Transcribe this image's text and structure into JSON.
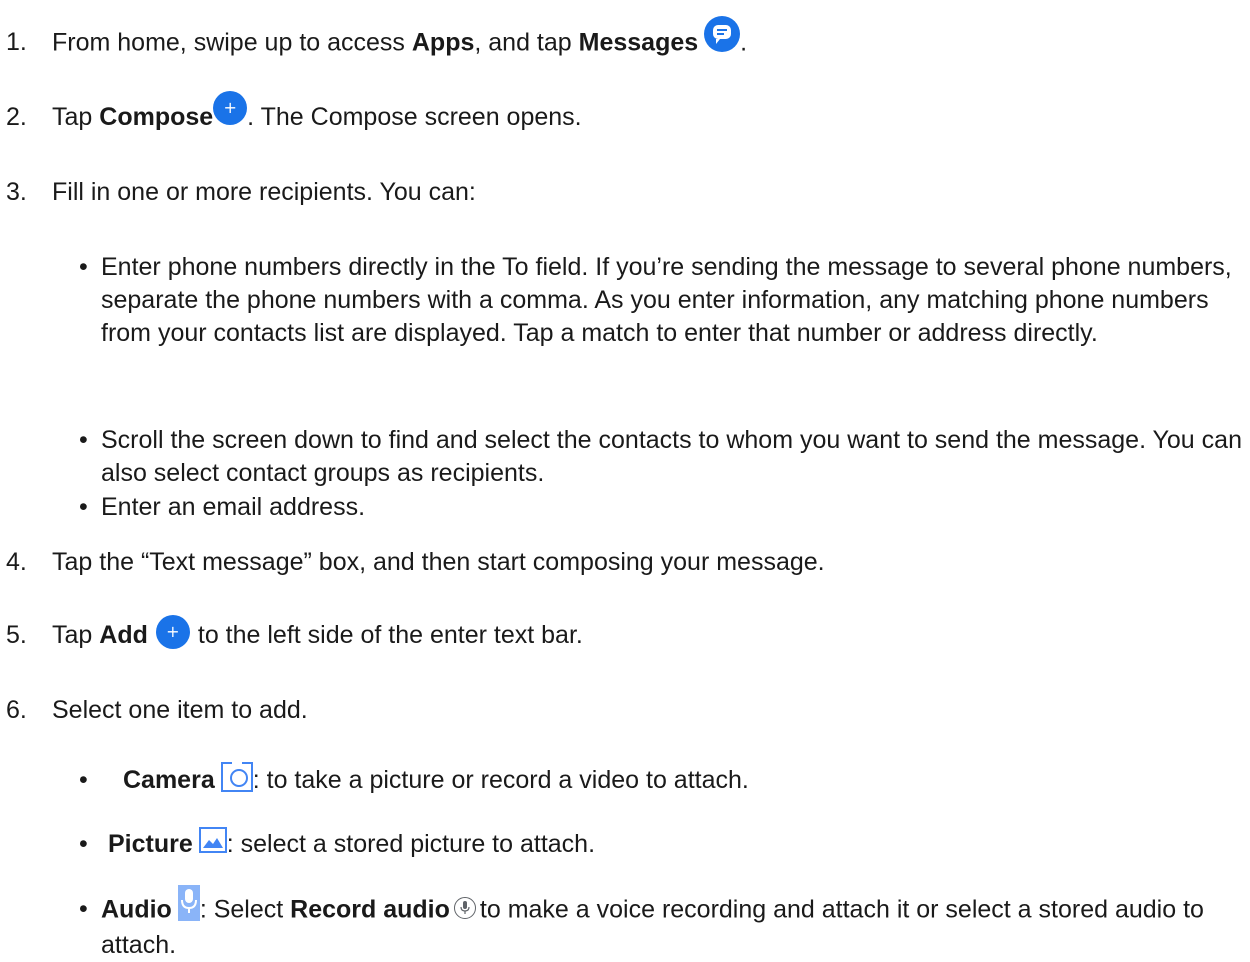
{
  "steps": [
    {
      "num": "1.",
      "pre": "From home, swipe up to access ",
      "b1": "Apps",
      "mid": ", and tap ",
      "b2": "Messages",
      "post": "."
    },
    {
      "num": "2.",
      "pre": "Tap ",
      "b1": "Compose",
      "post": ". The Compose screen opens."
    },
    {
      "num": "3.",
      "text": "Fill in one or more recipients. You can:"
    },
    {
      "num": "4.",
      "text": "Tap the “Text message” box, and then start composing your message."
    },
    {
      "num": "5.",
      "pre": "Tap ",
      "b1": "Add",
      "post": "to the left side of the enter text bar."
    },
    {
      "num": "6.",
      "text": "Select one item to add."
    }
  ],
  "recipient_bullets": [
    "Enter phone numbers directly in the To field. If you’re sending the message to several phone numbers, separate the phone numbers with a comma. As you enter information, any matching phone numbers from your contacts list are displayed. Tap a match to enter that number or address directly.",
    "Scroll the screen down to find and select the contacts to whom you want to send the message. You can also select contact groups as recipients.",
    "Enter an email address."
  ],
  "add_items": {
    "bullet": "•",
    "camera": {
      "label": "Camera",
      "desc": ": to take a picture or record a video to attach.",
      "icon": "camera-icon"
    },
    "picture": {
      "label": "Picture",
      "desc": ": select a stored picture to attach.",
      "icon": "picture-icon"
    },
    "audio": {
      "label": "Audio",
      "desc_pre": ": Select ",
      "record_label": "Record audio",
      "desc_post": "to make a voice recording and attach it or select a stored audio to attach.",
      "icon": "microphone-icon"
    }
  },
  "colors": {
    "accent": "#1a73e8",
    "icon_blue": "#4285f4",
    "mic_bg": "#8ab4f8",
    "text": "#1a1a1a"
  }
}
